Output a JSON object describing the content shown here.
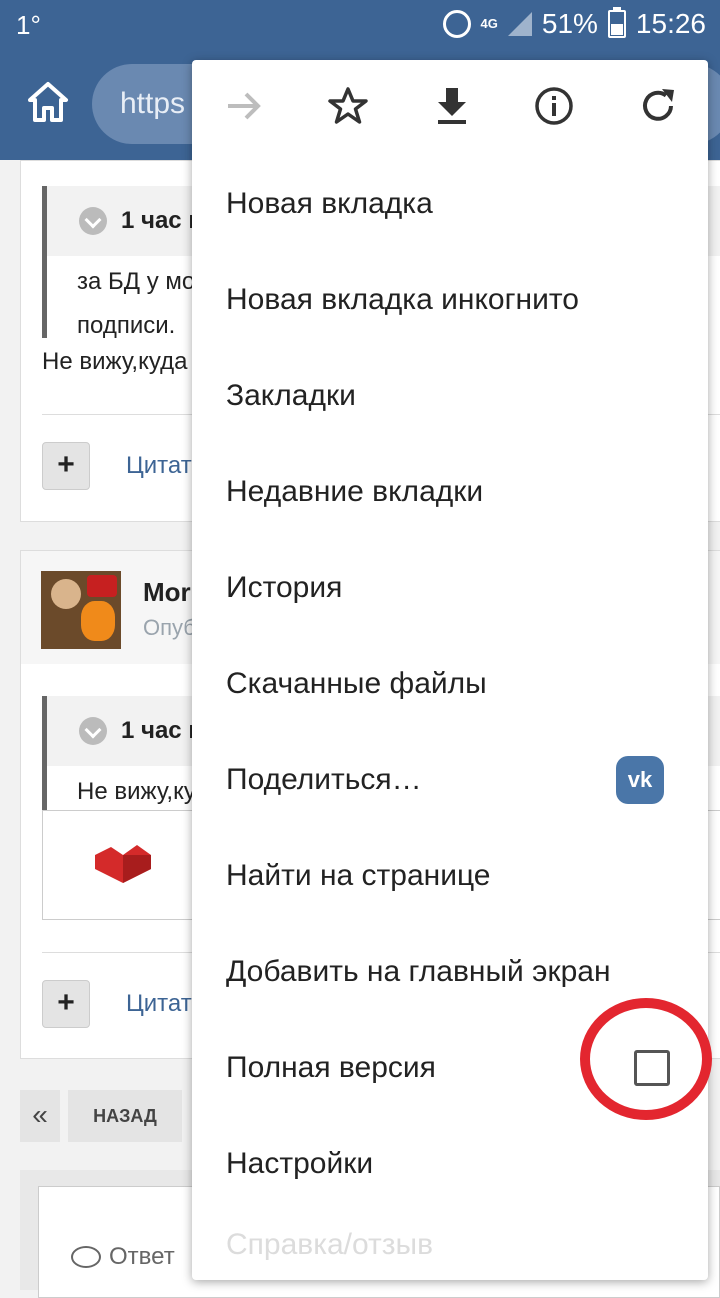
{
  "status_bar": {
    "left_text": "1°",
    "network": "4G",
    "battery": "51%",
    "time": "15:26"
  },
  "browser": {
    "url_partial": "https"
  },
  "content": {
    "post1": {
      "quote_time": "1 час н",
      "quote_line1": "за БД у мо",
      "quote_line2": "подписи.",
      "text": "Не вижу,куда",
      "plus": "+",
      "cite": "Цитат"
    },
    "post2": {
      "author": "Mor",
      "meta": "Опуб",
      "quote_time": "1 час н",
      "quote_line1": "Не вижу,ку",
      "plus": "+",
      "cite": "Цитат"
    },
    "pager": {
      "prev": "«",
      "back": "НАЗАД"
    },
    "reply_label": "Ответ"
  },
  "menu": {
    "icons": [
      "forward-icon",
      "star-icon",
      "download-icon",
      "info-icon",
      "reload-icon"
    ],
    "items": [
      "Новая вкладка",
      "Новая вкладка инкогнито",
      "Закладки",
      "Недавние вкладки",
      "История",
      "Скачанные файлы",
      "Поделиться…",
      "Найти на странице",
      "Добавить на главный экран",
      "Полная версия",
      "Настройки"
    ],
    "share_app": "vk",
    "full_version_checked": false,
    "faded_item": "Справка/отзыв"
  },
  "colors": {
    "toolbar": "#3d6494",
    "annotation": "#e3262f",
    "link": "#3d6494"
  }
}
